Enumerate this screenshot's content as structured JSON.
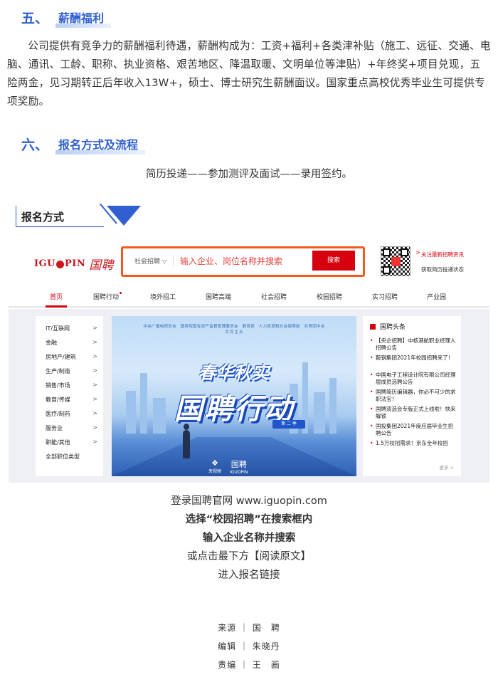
{
  "section5": {
    "num": "五、",
    "title": "薪酬福利",
    "body": "公司提供有竞争力的薪酬福利待遇，薪酬构成为：工资+福利+各类津补贴（施工、远征、交通、电脑、通讯、工龄、职称、执业资格、艰苦地区、降温取暖、文明单位等津贴）+年终奖+项目兑现，五险两金，见习期转正后年收入13W+，硕士、博士研究生薪酬面议。国家重点高校优秀毕业生可提供专项奖励。"
  },
  "section6": {
    "num": "六、",
    "title": "报名方式及流程",
    "flow": "简历投递——参加测评及面试——录用签约。"
  },
  "tab": {
    "label": "报名方式"
  },
  "site": {
    "logo_text_left": "IGU",
    "logo_text_right": "PIN",
    "logo_cn": "国聘",
    "search": {
      "type_label": "社会招聘",
      "type_caret": "▽",
      "placeholder": "输入企业、岗位名称并搜索",
      "button": "搜索"
    },
    "qr_note_1": "关注最新招聘资讯",
    "qr_note_2": "获取简历投递状态",
    "qr_arrow": ">",
    "nav": [
      "首页",
      "国聘行动",
      "境外招工",
      "国聘高端",
      "社会招聘",
      "校园招聘",
      "实习招聘",
      "产业园"
    ],
    "categories": [
      "IT/互联网",
      "金融",
      "房地产/建筑",
      "生产/制造",
      "销售/市场",
      "教育/传媒",
      "医疗/制药",
      "服务业",
      "职能/其他",
      "全部职位类型"
    ],
    "chevron": ">",
    "banner": {
      "top_line": "中央广播电视总台　国务院国有资产监督管理委员会　教育部　人力资源和社会保障部　共青团中央",
      "top_line2": "共 同 主 办",
      "title1": "春华秋实",
      "title2": "国聘行动",
      "season": "第 二 季",
      "logo1": "央视频",
      "logo2": "IGUOPIN",
      "logo1_glyph": "❖",
      "logo2_glyph": "国聘"
    },
    "news": {
      "title": "国聘头条",
      "items": [
        "【央企招聘】中核港航职业经理人招聘公告",
        "鞍钢集团2021年校园招聘来了！",
        "中国电子工程设计院有限公司经理层成员选聘公告",
        "国聘简历编辑器，你必不可少的求职法宝！",
        "国聘双选会专版正式上线啦！快来解锁",
        "国投集团2021年度应届毕业生招聘公告",
        "1.5万校招需求！京东全年校招"
      ],
      "more": "更多 >"
    }
  },
  "instructions": {
    "line1": "登录国聘官网 www.iguopin.com",
    "line2": "选择“校园招聘”在搜索框内",
    "line3": "输入企业名称并搜索",
    "line4": "或点击最下方【阅读原文】",
    "line5": "进入报名链接"
  },
  "credits": {
    "source": "来源 ｜ 国　聘",
    "editor": "编辑 ｜ 朱晓丹",
    "chief": "责编 ｜ 王　画"
  }
}
